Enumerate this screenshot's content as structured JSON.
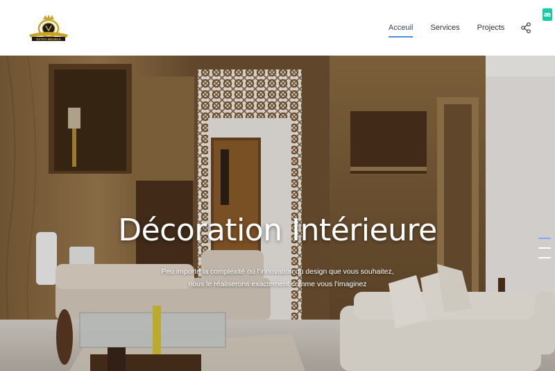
{
  "brand": {
    "logo_text": "EXTRA MEUBLE"
  },
  "nav": {
    "items": [
      {
        "label": "Acceuil",
        "active": true
      },
      {
        "label": "Services",
        "active": false
      },
      {
        "label": "Projects",
        "active": false
      }
    ],
    "share_icon": "share-icon"
  },
  "badge": {
    "text": "æ",
    "color": "#19c9a6"
  },
  "hero": {
    "title": "Décoration Intérieure",
    "subtitle": "Peu importe la complexité ou l'innovation du design que vous souhaitez, nous le réaliserons exactement comme vous l'imaginez",
    "slides": {
      "count": 3,
      "active_index": 0
    }
  },
  "colors": {
    "accent": "#4a90d9",
    "text": "#333333",
    "wood": "#8a6a40"
  }
}
